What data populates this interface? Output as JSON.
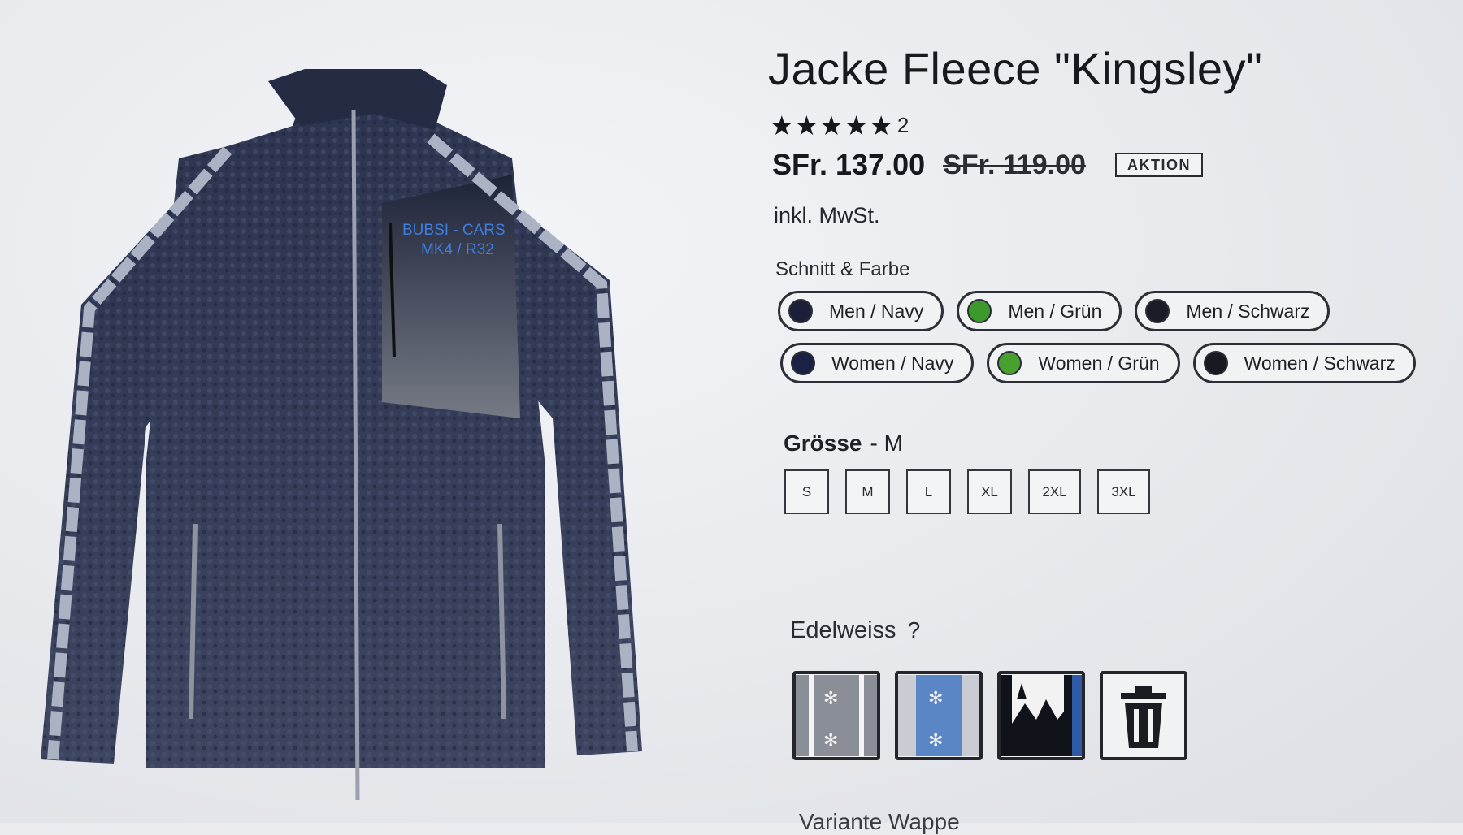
{
  "product": {
    "title": "Jacke Fleece \"Kingsley\"",
    "rating_count": "2",
    "stars": "★★★★★",
    "price": "SFr. 137.00",
    "price_old": "SFr. 119.00",
    "badge": "AKTION",
    "vat_note": "inkl. MwSt."
  },
  "image": {
    "embroidery_line1": "BUBSI - CARS",
    "embroidery_line2": "MK4 / R32"
  },
  "variants": {
    "label": "Schnitt & Farbe",
    "rows": [
      [
        {
          "label": "Men / Navy",
          "color": "#1b2038"
        },
        {
          "label": "Men / Grün",
          "color": "#3c9a2c"
        },
        {
          "label": "Men / Schwarz",
          "color": "#1a1c26"
        }
      ],
      [
        {
          "label": "Women / Navy",
          "color": "#1b2144"
        },
        {
          "label": "Women / Grün",
          "color": "#48a02e"
        },
        {
          "label": "Women / Schwarz",
          "color": "#181a22"
        }
      ]
    ]
  },
  "size": {
    "label": "Grösse",
    "selected": "- M",
    "options": [
      "S",
      "M",
      "L",
      "XL",
      "2XL",
      "3XL"
    ]
  },
  "edelweiss": {
    "label": "Edelweiss",
    "help": "?",
    "options": [
      "edelweiss-grey-pattern",
      "edelweiss-blue-pattern",
      "alpine-landscape-pattern",
      "trash-icon"
    ]
  },
  "cut_off_text": "Variante Wappe"
}
